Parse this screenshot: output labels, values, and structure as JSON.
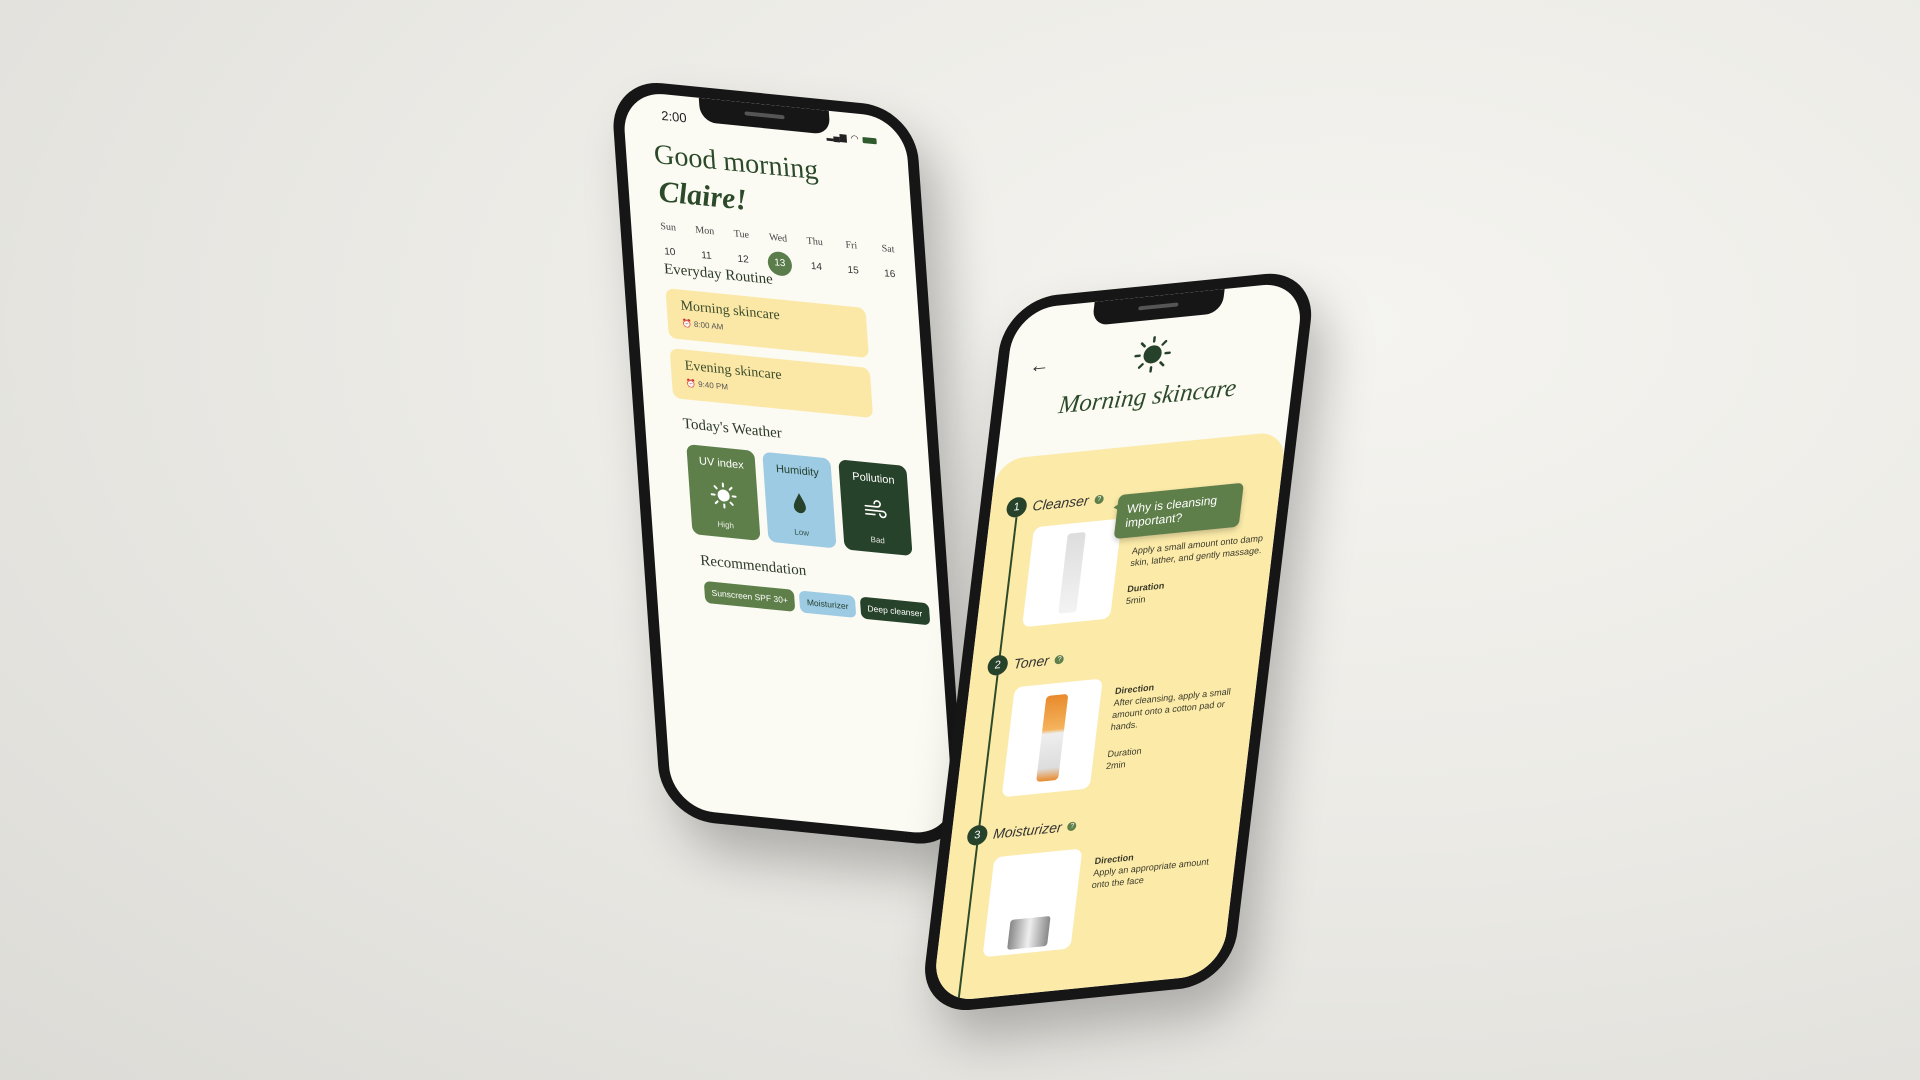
{
  "home": {
    "time": "2:00",
    "greeting": "Good morning",
    "name": "Claire!",
    "days": [
      {
        "n": "Sun",
        "d": "10"
      },
      {
        "n": "Mon",
        "d": "11"
      },
      {
        "n": "Tue",
        "d": "12"
      },
      {
        "n": "Wed",
        "d": "13",
        "selected": true
      },
      {
        "n": "Thu",
        "d": "14"
      },
      {
        "n": "Fri",
        "d": "15"
      },
      {
        "n": "Sat",
        "d": "16"
      }
    ],
    "routine_title": "Everyday Routine",
    "routines": [
      {
        "title": "Morning skincare",
        "time": "8:00 AM"
      },
      {
        "title": "Evening skincare",
        "time": "9:40 PM"
      }
    ],
    "weather_title": "Today's Weather",
    "weather": [
      {
        "label": "UV index",
        "value": "High",
        "icon": "sun-icon"
      },
      {
        "label": "Humidity",
        "value": "Low",
        "icon": "water-drop-icon"
      },
      {
        "label": "Pollution",
        "value": "Bad",
        "icon": "wind-icon"
      }
    ],
    "rec_title": "Recommendation",
    "recs": [
      "Sunscreen SPF 30+",
      "Moisturizer",
      "Deep cleanser"
    ]
  },
  "detail": {
    "title": "Morning skincare",
    "tooltip": "Why is cleansing important?",
    "steps": [
      {
        "num": "1",
        "name": "Cleanser",
        "direction_label": "",
        "direction": "Apply a small amount onto damp skin, lather, and gently massage.",
        "duration_label": "Duration",
        "duration": "5min"
      },
      {
        "num": "2",
        "name": "Toner",
        "direction_label": "Direction",
        "direction": "After cleansing, apply a small amount onto a cotton pad or hands.",
        "duration_label": "Duration",
        "duration": "2min"
      },
      {
        "num": "3",
        "name": "Moisturizer",
        "direction_label": "Direction",
        "direction": "Apply an appropriate amount onto the face"
      }
    ]
  },
  "colors": {
    "dark_green": "#27422a",
    "green": "#5f7f4a",
    "yellow": "#fbeaa8",
    "blue": "#9dcbe3",
    "screen": "#fbfaf3"
  }
}
